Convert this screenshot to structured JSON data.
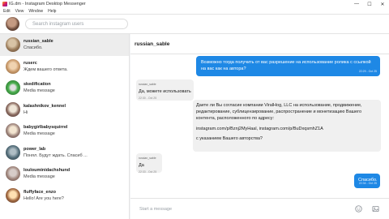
{
  "window": {
    "title": "IG.dm - Instagram Desktop Messenger",
    "minimize": "—",
    "maximize": "☐",
    "close": "✕"
  },
  "menu": [
    "Edit",
    "View",
    "Window",
    "Help"
  ],
  "search": {
    "placeholder": "Search instagram users"
  },
  "conversations": [
    {
      "username": "russian_sable",
      "preview": "Спасибо.",
      "avatar_color": "#9a7b5a"
    },
    {
      "username": "ruserc",
      "preview": "Ждем вашего ответа.",
      "avatar_color": "#c99a6b"
    },
    {
      "username": "skedification",
      "preview": "Media message",
      "avatar_color": "#2e7d32"
    },
    {
      "username": "kalashnikov_kennel",
      "preview": "Hi",
      "avatar_color": "#5d4037"
    },
    {
      "username": "babygirlbabysquirrel",
      "preview": "Media message",
      "avatar_color": "#8d6e63"
    },
    {
      "username": "power_lab",
      "preview": "Понял. Будут ждать. Спасиб ...",
      "avatar_color": "#37474f"
    },
    {
      "username": "loulouminidachshund",
      "preview": "Media message",
      "avatar_color": "#a1887f"
    },
    {
      "username": "fluffyface_enzo",
      "preview": "Hello! Are you here?",
      "avatar_color": "#6d4c41"
    }
  ],
  "chat": {
    "header": "russian_sable",
    "messages": [
      {
        "text": "Возможно тогда получить от вас разрешение на использование ролика с ссылкой на вас как на автора?",
        "time": "22:29 - Oct 25"
      },
      {
        "sender": "russian_sable",
        "text": "Да, можете использовать",
        "time": "22:30 - Oct 25"
      },
      {
        "lines": [
          "Дaете ли Вы согласие компании ViralHog, LLC на использование, продвижение,",
          "редактирование, сублицензирование, распространение и монетизацию Вашего",
          "контента, расположенного по адресу:",
          "",
          "instagram.com/p/Bznj2MyHaal, instagram.com/p/BuDxqsmhZ1A",
          "",
          "с указанием Вашего авторства?"
        ]
      },
      {
        "sender": "russian_sable",
        "text": "Да",
        "time": "22:33 - Oct 25"
      },
      {
        "text": "Спасибо.",
        "time": "22:34 - Oct 25"
      }
    ]
  },
  "composer": {
    "placeholder": "Start a message"
  }
}
